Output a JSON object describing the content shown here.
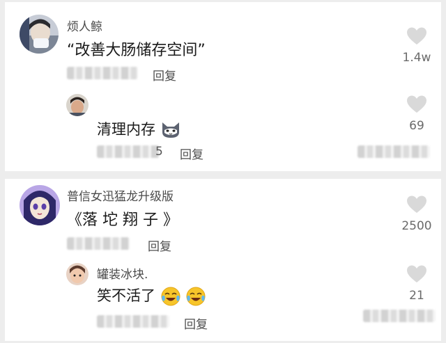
{
  "comments": [
    {
      "username": "烦人鲸",
      "content": "“改善大肠储存空间”",
      "reply_label": "回复",
      "likes": "1.4w",
      "reply": {
        "content": "清理内存",
        "date_suffix": "5",
        "reply_label": "回复",
        "likes": "69"
      }
    },
    {
      "username": "普信女迅猛龙升级版",
      "content": "《落 坨 翔 子 》",
      "reply_label": "回复",
      "likes": "2500",
      "reply": {
        "username": "罐装冰块.",
        "content": "笑不活了",
        "reply_label": "回复",
        "likes": "21"
      }
    }
  ],
  "colors": {
    "background": "#ededed",
    "card": "#ffffff",
    "heart": "#d9d9d9"
  },
  "icons": [
    "heart-icon",
    "cat-emoji-icon",
    "laugh-cry-emoji-icon"
  ]
}
